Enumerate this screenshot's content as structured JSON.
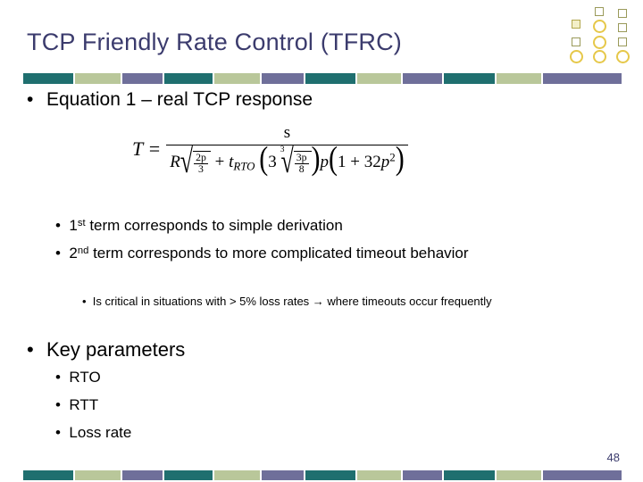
{
  "slide": {
    "title": "TCP Friendly Rate Control (TFRC)",
    "page_number": "48",
    "bullets": {
      "equation_intro": "Equation 1 – real TCP response",
      "term1": "1st term corresponds to simple derivation",
      "term2": "2nd term corresponds to more complicated timeout behavior",
      "term2_sub": "Is critical in situations with > 5% loss rates → where timeouts occur frequently",
      "key_parameters": "Key parameters",
      "param_rto": "RTO",
      "param_rtt": "RTT",
      "param_loss_rate": "Loss rate"
    },
    "equation": {
      "lhs": "T =",
      "numerator": "s",
      "denominator_text": "R sqrt(2p/3) + t_RTO (3 sqrt(3p/8)) p (1 + 32 p^2)",
      "symbols": {
        "T": "T",
        "s": "s",
        "R": "R",
        "t_rto": "t",
        "t_rto_sub": "RTO",
        "coef3": "3",
        "frac1_num": "2p",
        "frac1_den": "3",
        "frac2_num": "3p",
        "frac2_den": "8",
        "p": "p",
        "one_plus": "1 + 32",
        "p_squared_exp": "2"
      }
    },
    "top_bar_colors": [
      "#1f6f6f",
      "#b9c79a",
      "#6f6f9a",
      "#1f6f6f",
      "#b9c79a",
      "#6f6f9a",
      "#1f6f6f",
      "#b9c79a",
      "#6f6f9a",
      "#1f6f6f",
      "#b9c79a",
      "#6f6f9a"
    ],
    "bottom_bar_colors": [
      "#1f6f6f",
      "#b9c79a",
      "#6f6f9a",
      "#1f6f6f",
      "#b9c79a",
      "#6f6f9a",
      "#1f6f6f",
      "#b9c79a",
      "#6f6f9a",
      "#1f6f6f",
      "#b9c79a",
      "#6f6f9a"
    ],
    "accent_color": "#3b3b6d"
  }
}
